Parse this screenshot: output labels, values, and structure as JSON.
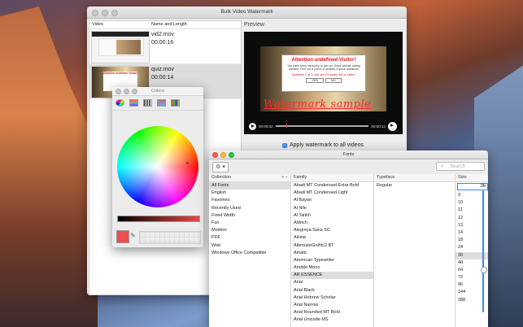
{
  "main_window": {
    "title": "Bulk Video Watermark",
    "columns": [
      "Video",
      "Name and Length"
    ],
    "videos": [
      {
        "name": "vid2.mov",
        "duration": "00:00:16"
      },
      {
        "name": "quiz.mov",
        "duration": "00:00:14"
      }
    ],
    "thumb_caption": "Attention undefined Visitor!",
    "preview_label": "Preview",
    "dialog": {
      "heading": "Attention undefined Visitor!",
      "text": "You have been randomly to join our South African dating website. Find out if you're to answer 3 quick questions",
      "question": "Question 1 of 3: Are you 21 years old or older?",
      "yes": "YES",
      "no": "NO"
    },
    "watermark_text": "Watermark sample",
    "time_current": "00:00:02",
    "time_total": "00:00:14",
    "playback_progress": 0.12,
    "apply_all_label": "Apply watermark to all videos",
    "apply_all_checked": true
  },
  "colors_panel": {
    "title": "Colors",
    "selected_color": "#ef4c55"
  },
  "fonts_panel": {
    "title": "Fonts",
    "search_placeholder": "Search",
    "collection_header": "Collection",
    "family_header": "Family",
    "typeface_header": "Typeface",
    "size_header": "Size",
    "collections": [
      "All Fonts",
      "English",
      "Favorites",
      "Recently Used",
      "Fixed Width",
      "Fun",
      "Modern",
      "PDF",
      "Web",
      "Windows Office Compatible"
    ],
    "selected_collection": "All Fonts",
    "families": [
      "Abadi MT Condensed Extra Bold",
      "Abadi MT Condensed Light",
      "Al Bayan",
      "Al Nile",
      "Al Tarikh",
      "Aldrich",
      "Alegreya Sans SC",
      "Alsina",
      "AlternateGothic2 BT",
      "Amatic",
      "American Typewriter",
      "Andale Mono",
      "AR ESSENCE",
      "Arial",
      "Arial Black",
      "Arial Hebrew Scholar",
      "Arial Narrow",
      "Arial Rounded MT Bold",
      "Arial Unicode MS"
    ],
    "selected_family": "AR ESSENCE",
    "typefaces": [
      "Regular"
    ],
    "size_value": "36",
    "sizes": [
      "9",
      "10",
      "11",
      "12",
      "13",
      "14",
      "18",
      "24",
      "36",
      "48",
      "64",
      "72",
      "96",
      "144",
      "288"
    ],
    "selected_size": "36"
  }
}
